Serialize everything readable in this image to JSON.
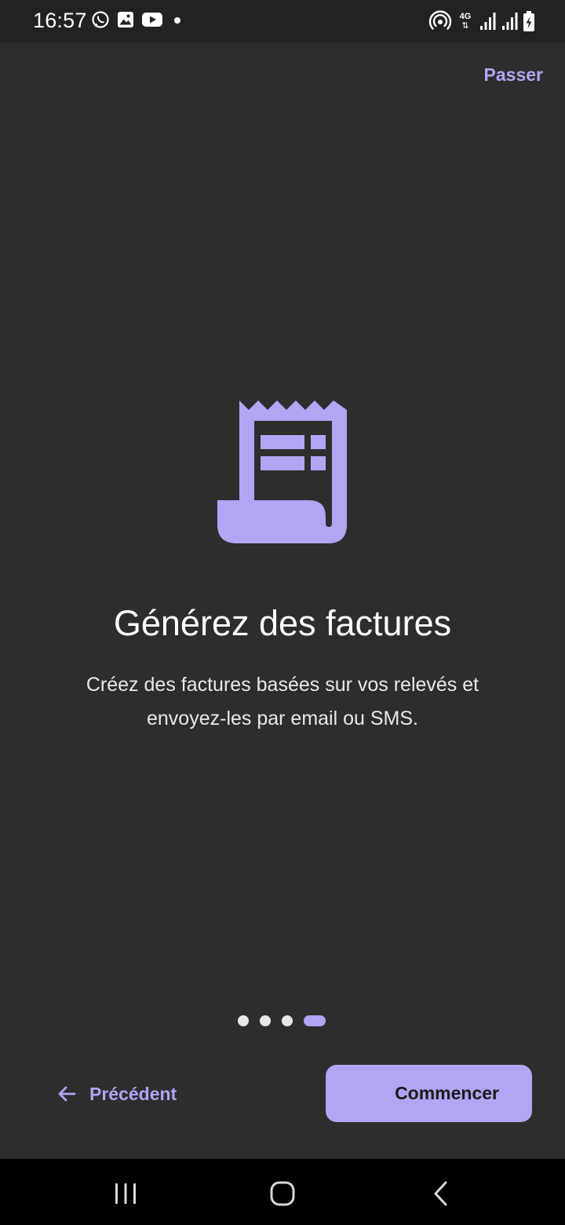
{
  "status_bar": {
    "time": "16:57",
    "left_icons": [
      "whatsapp-icon",
      "gallery-icon",
      "youtube-icon",
      "notification-dot-icon"
    ],
    "right_icons": [
      "hotspot-icon",
      "4g-icon",
      "signal-icon",
      "signal-icon",
      "battery-charging-icon"
    ],
    "network_label": "4G"
  },
  "skip_label": "Passer",
  "hero_icon": "receipt-icon",
  "slide": {
    "title": "Générez des factures",
    "description": "Créez des factures basées sur vos relevés et envoyez-les par email ou SMS."
  },
  "pager": {
    "total": 4,
    "active_index": 3
  },
  "actions": {
    "previous_label": "Précédent",
    "start_label": "Commencer"
  },
  "nav_bar": [
    "recents-icon",
    "home-icon",
    "back-icon"
  ],
  "colors": {
    "background": "#2d2d2d",
    "status_bar": "#222222",
    "accent": "#b3a4f4",
    "nav_bar": "#000000"
  }
}
